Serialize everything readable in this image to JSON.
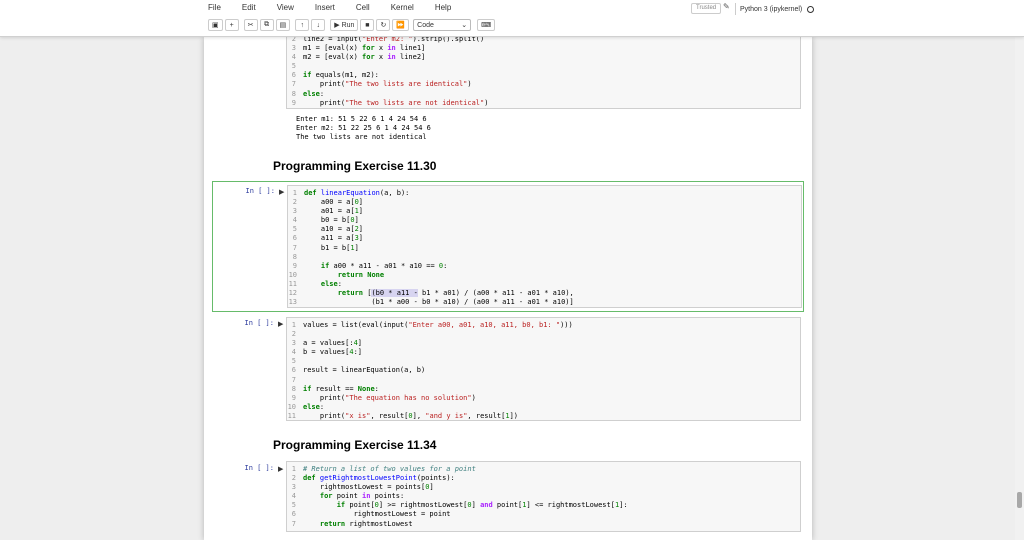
{
  "menu": [
    "File",
    "Edit",
    "View",
    "Insert",
    "Cell",
    "Kernel",
    "Help"
  ],
  "status": {
    "trusted": "Trusted",
    "kernel": "Python 3 (ipykernel)"
  },
  "toolbar": {
    "run_label": "Run",
    "cell_type": "Code"
  },
  "icons": {
    "save": "floppy-icon",
    "add": "plus-icon",
    "cut": "scissors-icon",
    "copy": "copy-icon",
    "paste": "paste-icon",
    "up": "arrow-up-icon",
    "down": "arrow-down-icon",
    "run": "play-icon",
    "stop": "stop-icon",
    "restart": "restart-icon",
    "fast_forward": "fast-forward-icon",
    "keyboard": "keyboard-icon"
  },
  "cell1": {
    "lines": [
      {
        "n": "2",
        "t": "line2 = input(\"Enter m2: \").strip().split()"
      },
      {
        "n": "3",
        "t": "m1 = [eval(x) for x in line1]"
      },
      {
        "n": "4",
        "t": "m2 = [eval(x) for x in line2]"
      },
      {
        "n": "5",
        "t": ""
      },
      {
        "n": "6",
        "t": "if equals(m1, m2):"
      },
      {
        "n": "7",
        "t": "    print(\"The two lists are identical\")"
      },
      {
        "n": "8",
        "t": "else:"
      },
      {
        "n": "9",
        "t": "    print(\"The two lists are not identical\")"
      }
    ],
    "output": [
      "Enter m1: 51 5 22 6 1 4 24 54 6",
      "Enter m2: 51 22 25 6 1 4 24 54 6",
      "The two lists are not identical"
    ]
  },
  "heading1": "Programming Exercise 11.30",
  "cell2": {
    "prompt": "In [ ]:",
    "lines": [
      {
        "n": "1",
        "t": "def linearEquation(a, b):"
      },
      {
        "n": "2",
        "t": "    a00 = a[0]"
      },
      {
        "n": "3",
        "t": "    a01 = a[1]"
      },
      {
        "n": "4",
        "t": "    b0 = b[0]"
      },
      {
        "n": "5",
        "t": "    a10 = a[2]"
      },
      {
        "n": "6",
        "t": "    a11 = a[3]"
      },
      {
        "n": "7",
        "t": "    b1 = b[1]"
      },
      {
        "n": "8",
        "t": ""
      },
      {
        "n": "9",
        "t": "    if a00 * a11 - a01 * a10 == 0:"
      },
      {
        "n": "10",
        "t": "        return None"
      },
      {
        "n": "11",
        "t": "    else:"
      },
      {
        "n": "12",
        "t": "        return [(b0 * a11 - b1 * a01) / (a00 * a11 - a01 * a10),"
      },
      {
        "n": "13",
        "t": "                (b1 * a00 - b0 * a10) / (a00 * a11 - a01 * a10)]"
      }
    ]
  },
  "cell3": {
    "prompt": "In [ ]:",
    "lines": [
      {
        "n": "1",
        "t": "values = list(eval(input(\"Enter a00, a01, a10, a11, b0, b1: \")))"
      },
      {
        "n": "2",
        "t": ""
      },
      {
        "n": "3",
        "t": "a = values[:4]"
      },
      {
        "n": "4",
        "t": "b = values[4:]"
      },
      {
        "n": "5",
        "t": ""
      },
      {
        "n": "6",
        "t": "result = linearEquation(a, b)"
      },
      {
        "n": "7",
        "t": ""
      },
      {
        "n": "8",
        "t": "if result == None:"
      },
      {
        "n": "9",
        "t": "    print(\"The equation has no solution\")"
      },
      {
        "n": "10",
        "t": "else:"
      },
      {
        "n": "11",
        "t": "    print(\"x is\", result[0], \"and y is\", result[1])"
      }
    ]
  },
  "heading2": "Programming Exercise 11.34",
  "cell4": {
    "prompt": "In [ ]:",
    "lines": [
      {
        "n": "1",
        "t": "# Return a list of two values for a point"
      },
      {
        "n": "2",
        "t": "def getRightmostLowestPoint(points):"
      },
      {
        "n": "3",
        "t": "    rightmostLowest = points[0]"
      },
      {
        "n": "4",
        "t": "    for point in points:"
      },
      {
        "n": "5",
        "t": "        if point[0] >= rightmostLowest[0] and point[1] <= rightmostLowest[1]:"
      },
      {
        "n": "6",
        "t": "            rightmostLowest = point"
      },
      {
        "n": "7",
        "t": "    return rightmostLowest"
      }
    ]
  },
  "colors": {
    "selected_border": "#66bb6a",
    "prompt": "#303f9f",
    "keyword": "#008000",
    "string": "#ba2121"
  }
}
